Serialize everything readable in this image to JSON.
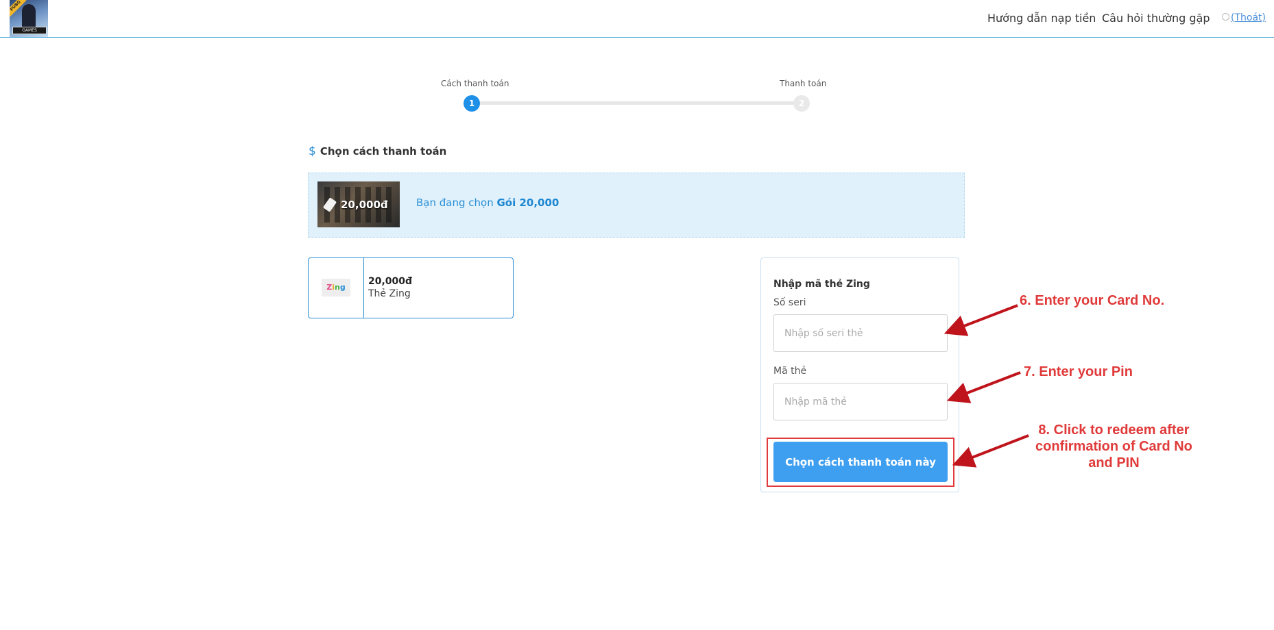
{
  "header": {
    "logo": {
      "ribbon_text": "PUBG",
      "band_text": "GAMES"
    },
    "nav": {
      "guide_label": "Hướng dẫn nạp tiền",
      "faq_label": "Câu hỏi thường gặp",
      "logout_label": "(Thoát)"
    }
  },
  "stepper": {
    "steps": [
      {
        "label": "Cách thanh toán",
        "number": "1",
        "active": true
      },
      {
        "label": "Thanh toán",
        "number": "2",
        "active": false
      }
    ]
  },
  "section": {
    "icon": "dollar-icon",
    "glyph": "$",
    "title": "Chọn cách thanh toán"
  },
  "banner": {
    "thumb_price": "20,000đ",
    "prefix": "Bạn đang chọn ",
    "package": "Gói 20,000"
  },
  "card_option": {
    "logo_letters": [
      "Z",
      "i",
      "n",
      "g"
    ],
    "amount": "20,000đ",
    "name": "Thẻ Zing"
  },
  "form": {
    "title": "Nhập mã thẻ Zing",
    "serial_label": "Số seri",
    "serial_placeholder": "Nhập số seri thẻ",
    "serial_value": "",
    "pin_label": "Mã thẻ",
    "pin_placeholder": "Nhập mã thẻ",
    "pin_value": "",
    "submit_label": "Chọn cách thanh toán này"
  },
  "annotations": {
    "step6": "6. Enter your Card No.",
    "step7": "7. Enter your Pin",
    "step8_lines": [
      "8. Click to redeem after",
      "confirmation of Card No",
      "and PIN"
    ]
  },
  "colors": {
    "accent": "#1e90e8",
    "button": "#3e9ef0",
    "banner_bg": "#e0f1fc",
    "annotation_red": "#e03a3a",
    "arrow_red": "#c0141c"
  }
}
